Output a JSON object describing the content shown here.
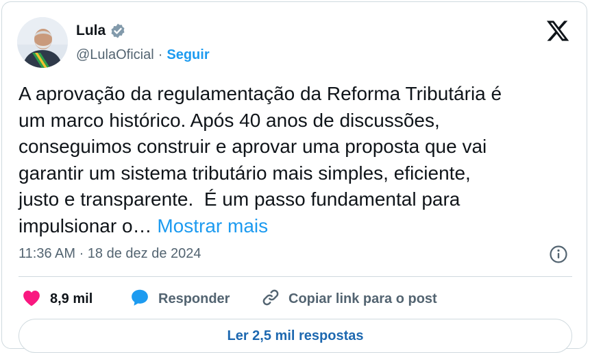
{
  "author": {
    "name": "Lula",
    "handle": "@LulaOficial",
    "separator": "·",
    "follow_label": "Seguir",
    "avatar_icon": "avatar-photo",
    "verified_icon": "verified-badge-icon"
  },
  "brand_icon": "x-logo-icon",
  "tweet": {
    "text": "A aprovação da regulamentação da Reforma Tributária é\num marco histórico. Após 40 anos de discussões,\nconseguimos construir e aprovar uma proposta que vai\ngarantir um sistema tributário mais simples, eficiente,\njusto e transparente.  É um passo fundamental para\nimpulsionar o… ",
    "show_more": "Mostrar mais"
  },
  "meta": {
    "timestamp": "11:36 AM · 18 de dez de 2024",
    "info_icon": "info-icon"
  },
  "actions": {
    "likes_count": "8,9 mil",
    "like_icon": "heart-icon",
    "reply_label": "Responder",
    "reply_icon": "speech-bubble-icon",
    "copy_label": "Copiar link para o post",
    "copy_icon": "link-icon"
  },
  "replies_button": "Ler 2,5 mil respostas",
  "colors": {
    "accent": "#1d9bf0",
    "like": "#f91880",
    "text": "#0f1419",
    "muted": "#536471",
    "border": "#cfd9de"
  }
}
